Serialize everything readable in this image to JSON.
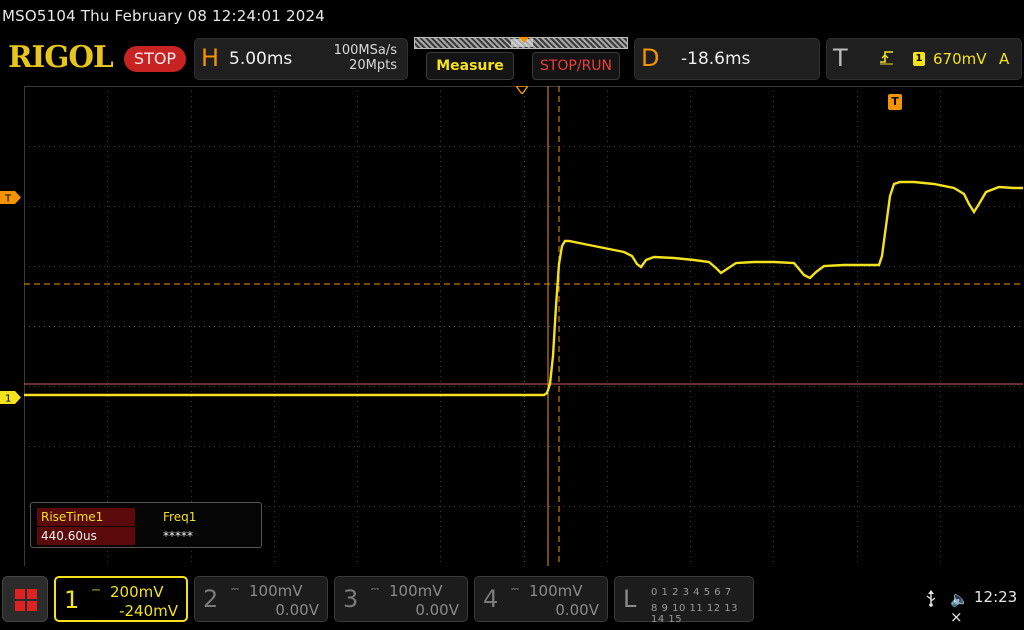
{
  "title_line": "MSO5104  Thu February 08 12:24:01 2024",
  "brand": "RIGOL",
  "run_state": "STOP",
  "horizontal": {
    "letter": "H",
    "timebase": "5.00ms",
    "sample_rate": "100MSa/s",
    "memory_depth": "20Mpts"
  },
  "buttons": {
    "measure": "Measure",
    "stop_run": "STOP/RUN"
  },
  "delay": {
    "letter": "D",
    "value": "-18.6ms"
  },
  "trigger": {
    "letter": "T",
    "edge_icon": "rising-edge-icon",
    "source": "1",
    "level": "670mV",
    "mode": "A"
  },
  "markers": {
    "trigger_level": "T",
    "channel1_ground": "1",
    "trigger_position": "T"
  },
  "measurements": {
    "items": [
      {
        "label": "RiseTime1",
        "value": "440.60us"
      },
      {
        "label": "Freq1",
        "value": "*****"
      }
    ]
  },
  "channels": [
    {
      "num": "1",
      "coupling": "DC",
      "scale": "200mV",
      "offset": "-240mV",
      "active": true
    },
    {
      "num": "2",
      "coupling": "DC",
      "scale": "100mV",
      "offset": "0.00V",
      "active": false
    },
    {
      "num": "3",
      "coupling": "DC",
      "scale": "100mV",
      "offset": "0.00V",
      "active": false
    },
    {
      "num": "4",
      "coupling": "DC",
      "scale": "100mV",
      "offset": "0.00V",
      "active": false
    }
  ],
  "logic": {
    "letter": "L",
    "row1": "0 1 2 3   4 5 6 7",
    "row2": "8 9 10 11 12 13 14 15"
  },
  "status": {
    "usb_icon": "usb-icon",
    "speaker_icon": "speaker-muted-icon",
    "clock": "12:23"
  },
  "colors": {
    "ch1": "#f4e21d",
    "accent": "#f39300",
    "stop": "#c82323",
    "grid": "#3a3a3a"
  }
}
